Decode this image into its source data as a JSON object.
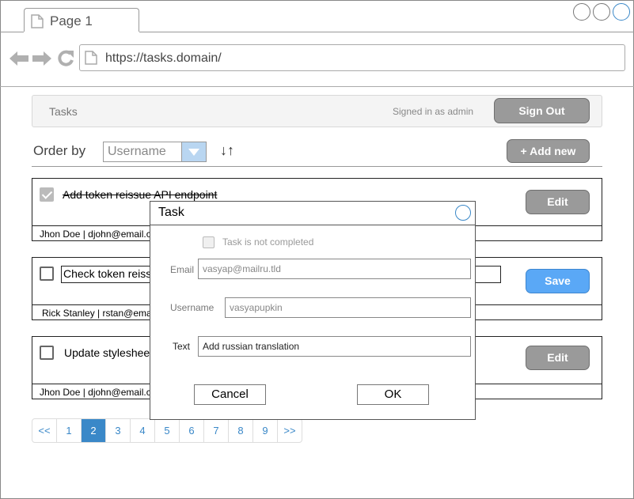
{
  "browser": {
    "tab_title": "Page 1",
    "url": "https://tasks.domain/"
  },
  "header": {
    "title": "Tasks",
    "signed_in": "Signed in as admin",
    "sign_out": "Sign Out"
  },
  "toolbar": {
    "order_by_label": "Order by",
    "order_by_value": "Username",
    "sort_glyph": "↓↑",
    "add_new": "+ Add new"
  },
  "tasks": [
    {
      "text": "Add token reissue API endpoint",
      "meta": "Jhon Doe | djohn@email.com",
      "completed": true,
      "action": "Edit"
    },
    {
      "text": "Check token reissue",
      "meta": "Rick Stanley | rstan@email.com",
      "completed": false,
      "action": "Save"
    },
    {
      "text": "Update stylesheet",
      "meta": "Jhon Doe | djohn@email.com",
      "completed": false,
      "action": "Edit"
    }
  ],
  "pagination": {
    "items": [
      "<<",
      "1",
      "2",
      "3",
      "4",
      "5",
      "6",
      "7",
      "8",
      "9",
      ">>"
    ],
    "active": "2"
  },
  "dialog": {
    "title": "Task",
    "completed_label": "Task is not completed",
    "email_label": "Email",
    "email_placeholder": "vasyap@mailru.tld",
    "username_label": "Username",
    "username_placeholder": "vasyapupkin",
    "text_label": "Text",
    "text_value": "Add russian translation",
    "cancel": "Cancel",
    "ok": "OK"
  }
}
